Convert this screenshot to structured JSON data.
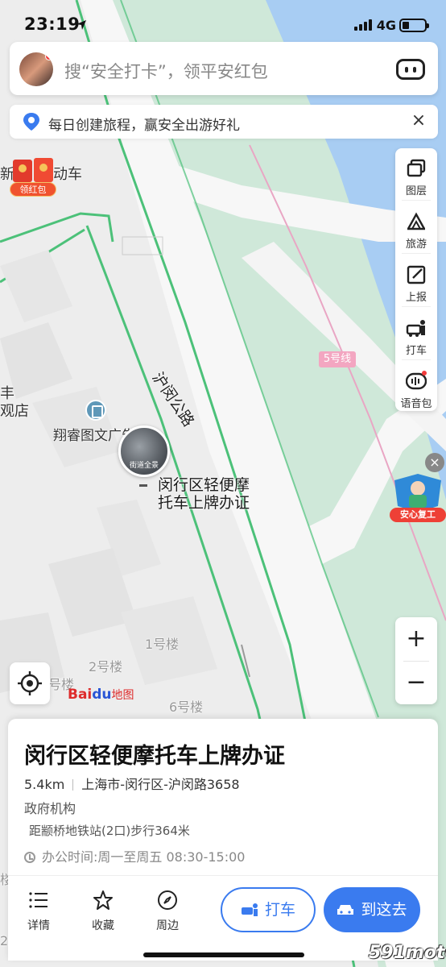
{
  "status_bar": {
    "time": "23:19",
    "network": "4G"
  },
  "search": {
    "placeholder": "搜“安全打卡”，领平安红包"
  },
  "promo": {
    "text": "每日创建旅程，赢安全出游好礼",
    "close": "×"
  },
  "redpacket": {
    "label": "领红包"
  },
  "side_toolbar": {
    "items": [
      {
        "label": "图层",
        "icon": "layers-icon"
      },
      {
        "label": "旅游",
        "icon": "travel-icon"
      },
      {
        "label": "上报",
        "icon": "report-icon"
      },
      {
        "label": "打车",
        "icon": "taxi-icon"
      },
      {
        "label": "语音包",
        "icon": "voice-pack-icon"
      }
    ]
  },
  "zoom": {
    "in": "+",
    "out": "−"
  },
  "map": {
    "road_label": "沪闵公路",
    "metro_line": "5号线",
    "left_labels": {
      "top": "新",
      "top2": "动车",
      "mid1": "丰",
      "mid2": "观店"
    },
    "poi_nearby": "翔睿图文广告",
    "buildings": [
      "1号楼",
      "2号楼",
      "号楼",
      "6号楼"
    ],
    "street_view_label": "街道全景",
    "poi_label_line1": "闵行区轻便摩",
    "poi_label_line2": "托车上牌办证",
    "bottom_left_fragment": "楼",
    "bottom_left_number": "2"
  },
  "badge": {
    "label": "安心复工",
    "close": "×"
  },
  "baidu_logo": {
    "bai": "Bai",
    "du": "du",
    "map": "地图"
  },
  "card": {
    "title": "闵行区轻便摩托车上牌办证",
    "distance": "5.4km",
    "address": "上海市-闵行区-沪闵路3658",
    "category": "政府机构",
    "subway": "距颛桥地铁站(2口)步行364米",
    "hours": "办公时间:周一至周五 08:30-15:00",
    "actions": [
      {
        "label": "详情",
        "icon": "details-list-icon"
      },
      {
        "label": "收藏",
        "icon": "star-icon"
      },
      {
        "label": "周边",
        "icon": "compass-icon"
      }
    ],
    "taxi_button": "打车",
    "go_button": "到这去"
  },
  "watermark": "591moto",
  "colors": {
    "accent": "#3a7bef",
    "water": "#a8cdf3",
    "green": "#cfe8d9",
    "road_green": "#4cc179"
  }
}
